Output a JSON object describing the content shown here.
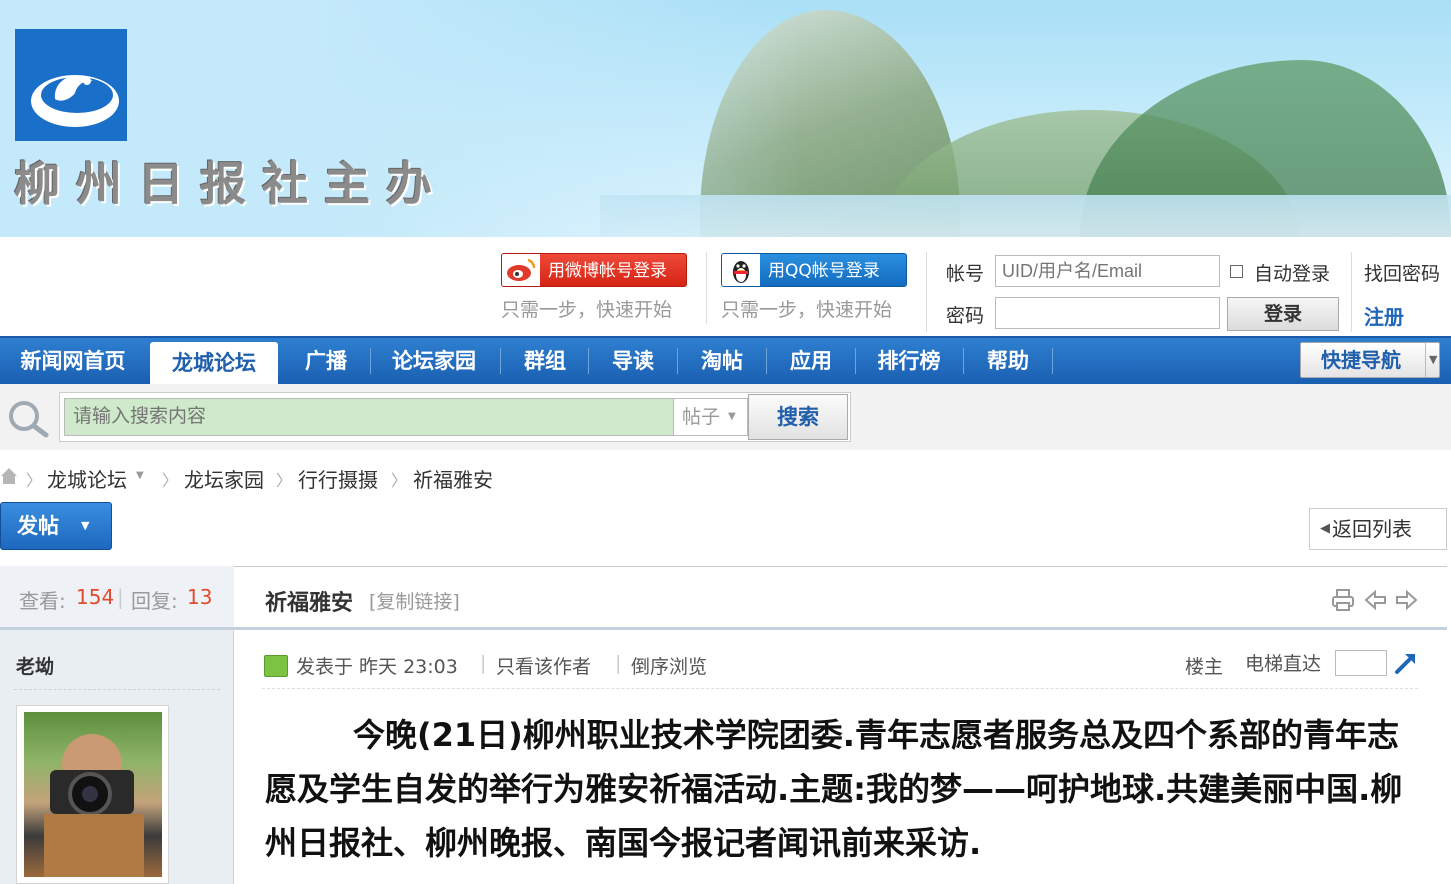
{
  "banner": {
    "title": "柳州日报社主办"
  },
  "login": {
    "weibo_label": "用微博帐号登录",
    "weibo_note": "只需一步，快速开始",
    "qq_label": "用QQ帐号登录",
    "qq_note": "只需一步，快速开始",
    "account_label": "帐号",
    "account_placeholder": "UID/用户名/Email",
    "auto_login_label": "自动登录",
    "find_password": "找回密码",
    "password_label": "密码",
    "login_button": "登录",
    "register": "注册"
  },
  "nav": {
    "items": [
      "新闻网首页",
      "龙城论坛",
      "广播",
      "论坛家园",
      "群组",
      "导读",
      "淘帖",
      "应用",
      "排行榜",
      "帮助"
    ],
    "quick_nav": "快捷导航"
  },
  "search": {
    "placeholder": "请输入搜索内容",
    "type": "帖子",
    "button": "搜索"
  },
  "breadcrumb": [
    "龙城论坛",
    "龙坛家园",
    "行行摄摄",
    "祈福雅安"
  ],
  "actions": {
    "post": "发帖",
    "back": "返回列表"
  },
  "thread": {
    "views_label": "查看:",
    "views": "154",
    "replies_label": "回复:",
    "replies": "13",
    "title": "祈福雅安",
    "copy_link": "[复制链接]"
  },
  "post": {
    "author": "老坳",
    "posted": "发表于 昨天 23:03",
    "only_author": "只看该作者",
    "reverse": "倒序浏览",
    "floor": "楼主",
    "elevator": "电梯直达",
    "body": "今晚(21日)柳州职业技术学院团委.青年志愿者服务总及四个系部的青年志愿及学生自发的举行为雅安祈福活动.主题:我的梦——呵护地球.共建美丽中国.柳州日报社、柳州晚报、南国今报记者闻讯前来采访."
  },
  "colors": {
    "nav_blue": "#1f66b8",
    "accent_red": "#e04b2b",
    "weibo_red": "#e03a2a",
    "qq_blue": "#1f7fd2"
  }
}
